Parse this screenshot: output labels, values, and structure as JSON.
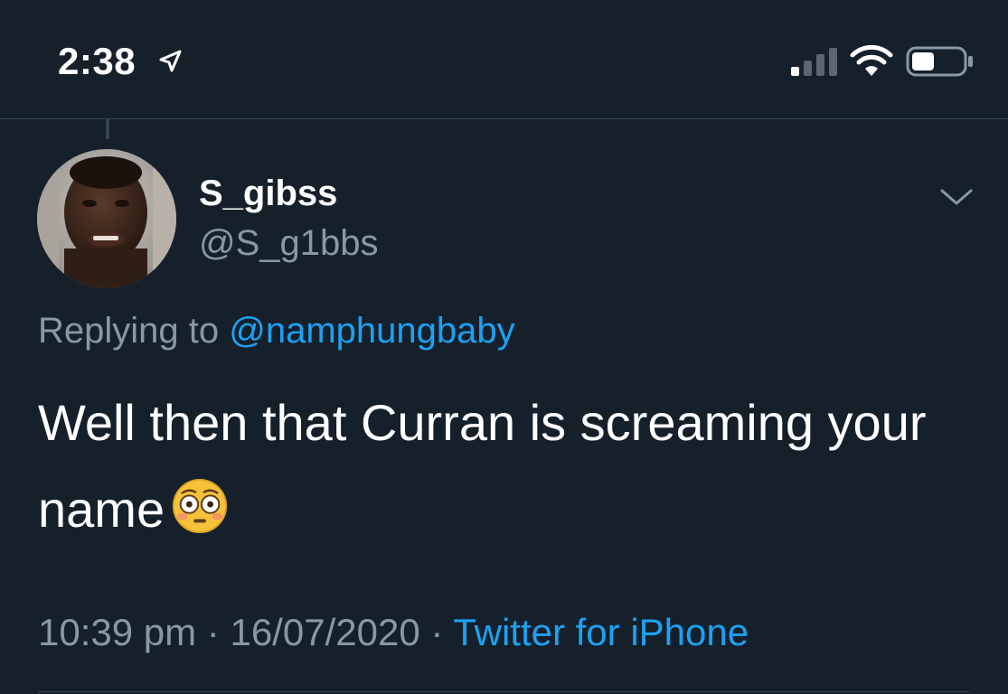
{
  "status_bar": {
    "time": "2:38"
  },
  "tweet": {
    "display_name": "S_gibss",
    "handle": "@S_g1bbs",
    "replying_prefix": "Replying to",
    "replying_to": "@namphungbaby",
    "text": "Well then that Curran is screaming your name",
    "emoji": "flushed-face",
    "time": "10:39 pm",
    "separator": "·",
    "date": "16/07/2020",
    "source": "Twitter for iPhone"
  },
  "colors": {
    "background": "#15202b",
    "secondary_text": "#8899a6",
    "link": "#1da1f2",
    "divider": "#38444d"
  },
  "icons": {
    "location": "location-arrow-icon",
    "signal": "cellular-signal-icon",
    "wifi": "wifi-icon",
    "battery": "battery-icon",
    "chevron": "chevron-down-icon"
  }
}
